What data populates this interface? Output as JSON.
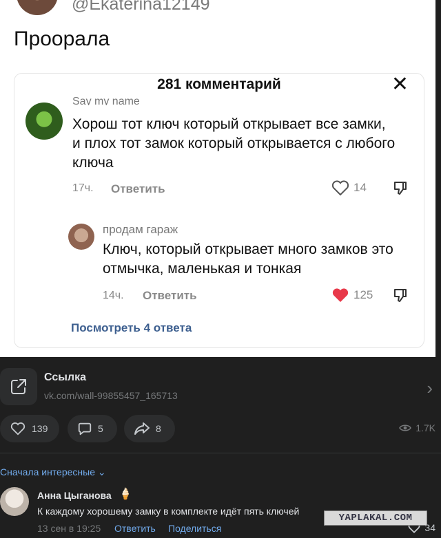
{
  "screenshot": {
    "username": "@Ekaterina12149",
    "post_text": "Проорала",
    "comments_panel": {
      "title": "281 комментарий",
      "close_icon": "close-icon",
      "comments": [
        {
          "author": "Say my name",
          "text": "Хорош тот ключ который открывает все замки, и плох тот замок который открывается с любого ключа",
          "time": "17ч.",
          "reply_label": "Ответить",
          "likes": "14",
          "liked": false
        },
        {
          "author": "продам гараж",
          "text": "Ключ, который открывает много замков это отмычка, маленькая и тонкая",
          "time": "14ч.",
          "reply_label": "Ответить",
          "likes": "125",
          "liked": true
        }
      ],
      "more_replies": "Посмотреть 4 ответа"
    }
  },
  "link_card": {
    "title": "Ссылка",
    "url": "vk.com/wall-99855457_165713",
    "icon": "external-link-icon"
  },
  "actions": {
    "likes": "139",
    "comments": "5",
    "shares": "8",
    "views": "1.7K"
  },
  "comments_section": {
    "sort_label": "Сначала интересные",
    "comment": {
      "author": "Анна Цыганова",
      "text": "К каждому хорошему замку в комплекте идёт пять ключей",
      "date": "13 сен в 19:25",
      "reply_label": "Ответить",
      "share_label": "Поделиться",
      "likes": "34"
    }
  },
  "watermark": "YAPLAKAL.COM",
  "colors": {
    "background": "#1f1f1f",
    "accent": "#71aaeb",
    "liked_heart": "#e8394a"
  }
}
